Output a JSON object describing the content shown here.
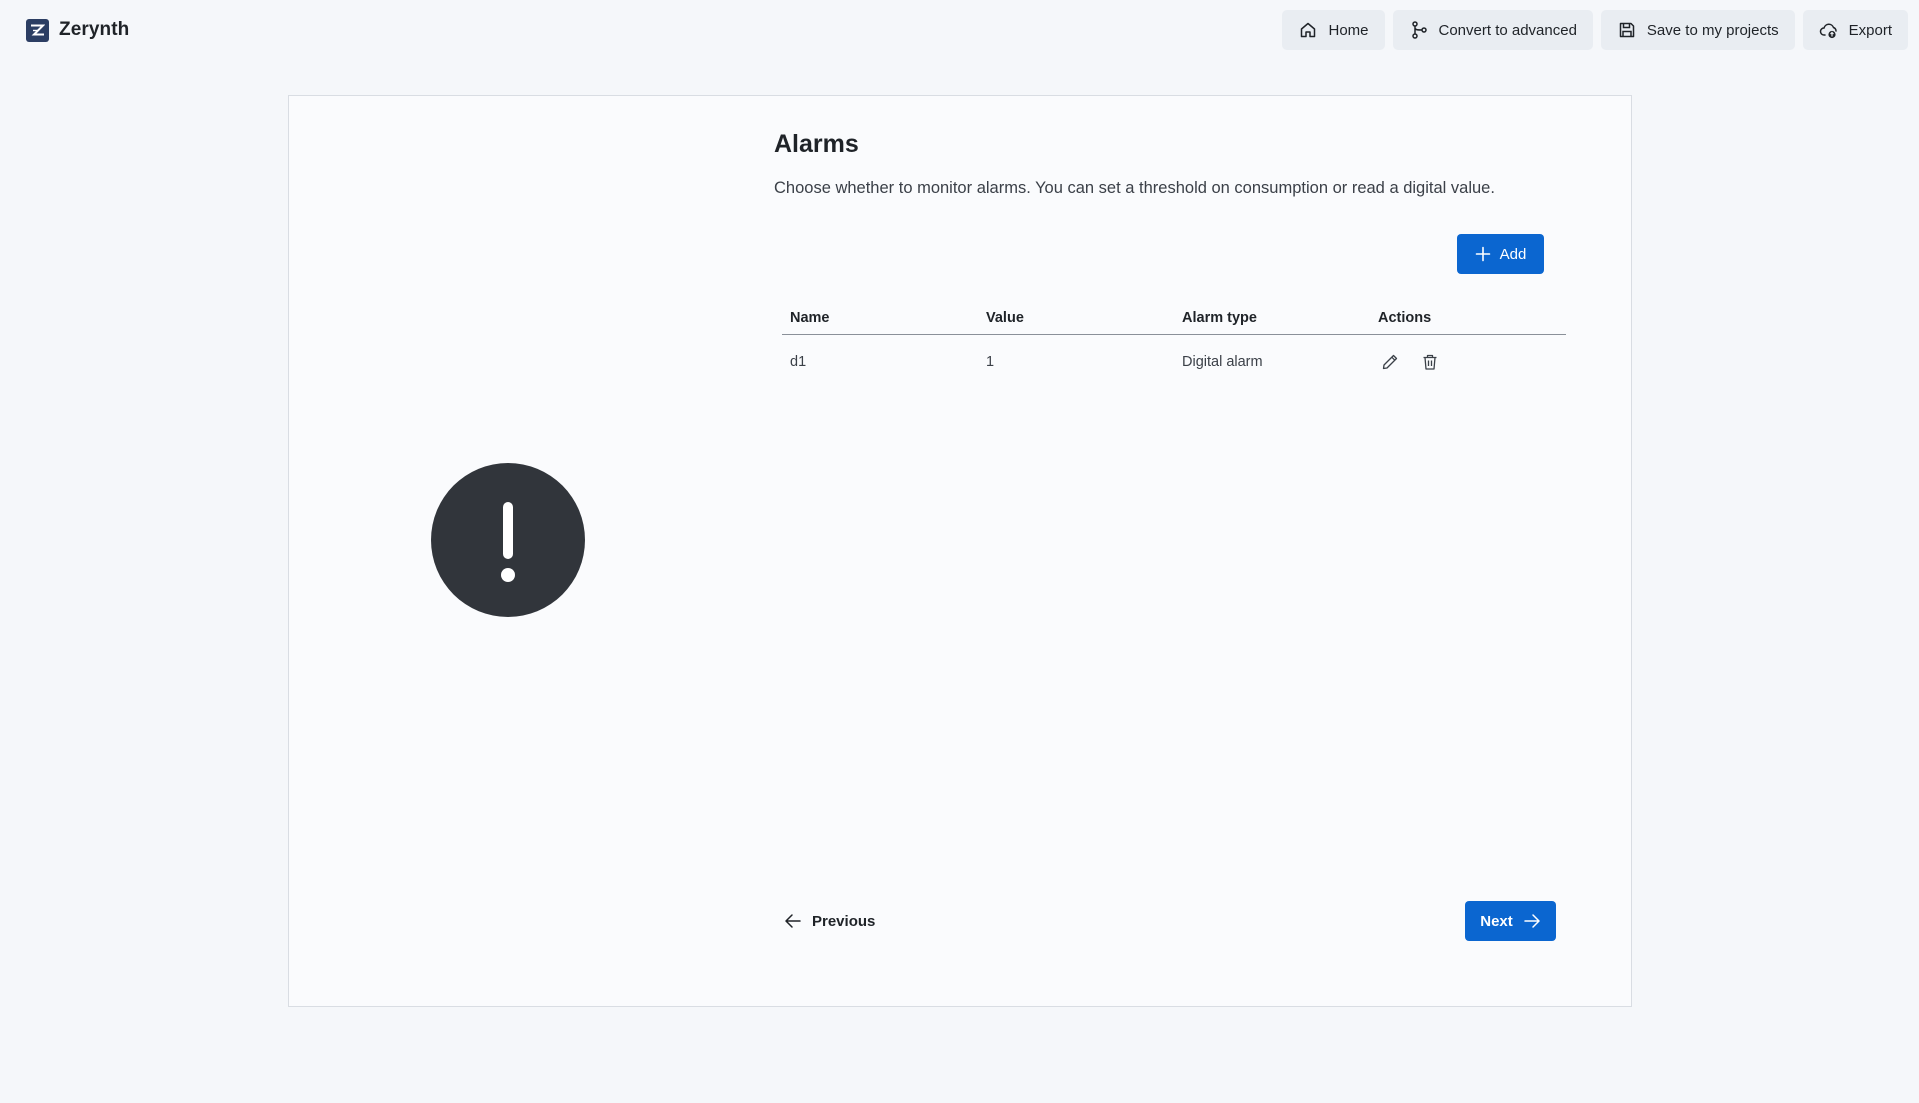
{
  "brand": {
    "name": "Zerynth",
    "logo_icon": "zerynth-logo-icon"
  },
  "nav": [
    {
      "label": "Home",
      "icon": "home-icon"
    },
    {
      "label": "Convert to advanced",
      "icon": "git-branch-icon"
    },
    {
      "label": "Save to my projects",
      "icon": "save-icon"
    },
    {
      "label": "Export",
      "icon": "cloud-export-icon"
    }
  ],
  "illustration": {
    "icon": "exclamation-icon",
    "color": "#31353b"
  },
  "page": {
    "title": "Alarms",
    "description": "Choose whether to monitor alarms. You can set a threshold on consumption or read a digital value.",
    "add_label": "Add"
  },
  "table": {
    "columns": [
      "Name",
      "Value",
      "Alarm type",
      "Actions"
    ],
    "rows": [
      {
        "name": "d1",
        "value": "1",
        "alarm_type": "Digital alarm"
      }
    ]
  },
  "footer": {
    "previous_label": "Previous",
    "next_label": "Next"
  },
  "colors": {
    "accent": "#0b66d0",
    "background": "#f5f7fa",
    "nav_button": "#e9edf2"
  }
}
